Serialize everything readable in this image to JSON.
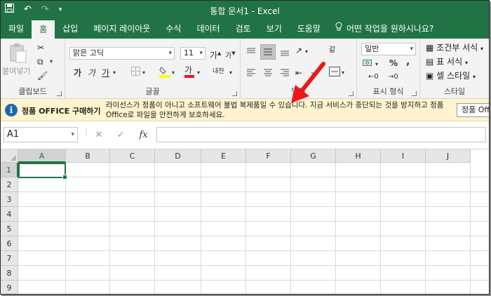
{
  "titlebar": {
    "title": "통합 문서1  -  Excel",
    "save_icon": "save-icon",
    "undo_icon": "undo-icon",
    "redo_icon": "redo-icon",
    "customize_icon": "customize-qat-icon"
  },
  "tabs": [
    "파일",
    "홈",
    "삽입",
    "페이지 레이아웃",
    "수식",
    "데이터",
    "검토",
    "보기",
    "도움말"
  ],
  "active_tab": "홈",
  "tell_me": "어떤 작업을 원하시나요?",
  "ribbon": {
    "clipboard": {
      "label": "클립보드",
      "paste": "붙여넣기"
    },
    "font": {
      "label": "글꼴",
      "font_name": "맑은 고딕",
      "font_size": "11",
      "bold": "가",
      "italic": "가",
      "underline": "가",
      "font_color_letter": "가",
      "phonetic": "내천"
    },
    "alignment": {
      "label": "맞춤",
      "wrap": "갊"
    },
    "number": {
      "label": "표시 형식",
      "format": "일반",
      "percent": "%",
      "comma": ","
    },
    "styles": {
      "label": "스타일",
      "conditional": "조건부 서식",
      "table": "표 서식",
      "cell": "셀 스타일"
    }
  },
  "message_bar": {
    "title": "정품 OFFICE 구매하기",
    "text": "라이선스가 정품이 아니고 소프트웨어 불법 복제품일 수 있습니다. 지금 서비스가 중단되는 것을 방지하고 정품 Office로 파일을 안전하게 보호하세요.",
    "button": "정품 Office"
  },
  "formula_bar": {
    "name_box": "A1",
    "formula": "",
    "fx": "fx",
    "cancel": "✕",
    "enter": "✓"
  },
  "grid": {
    "columns": [
      "A",
      "B",
      "C",
      "D",
      "E",
      "F",
      "G",
      "H",
      "I",
      "J"
    ],
    "rows": [
      "1",
      "2",
      "3",
      "4",
      "5",
      "6",
      "7",
      "8",
      "9"
    ],
    "active_cell": "A1"
  },
  "colors": {
    "accent": "#217346",
    "message_bg": "#fff4ce",
    "annotation": "#e8191b"
  }
}
